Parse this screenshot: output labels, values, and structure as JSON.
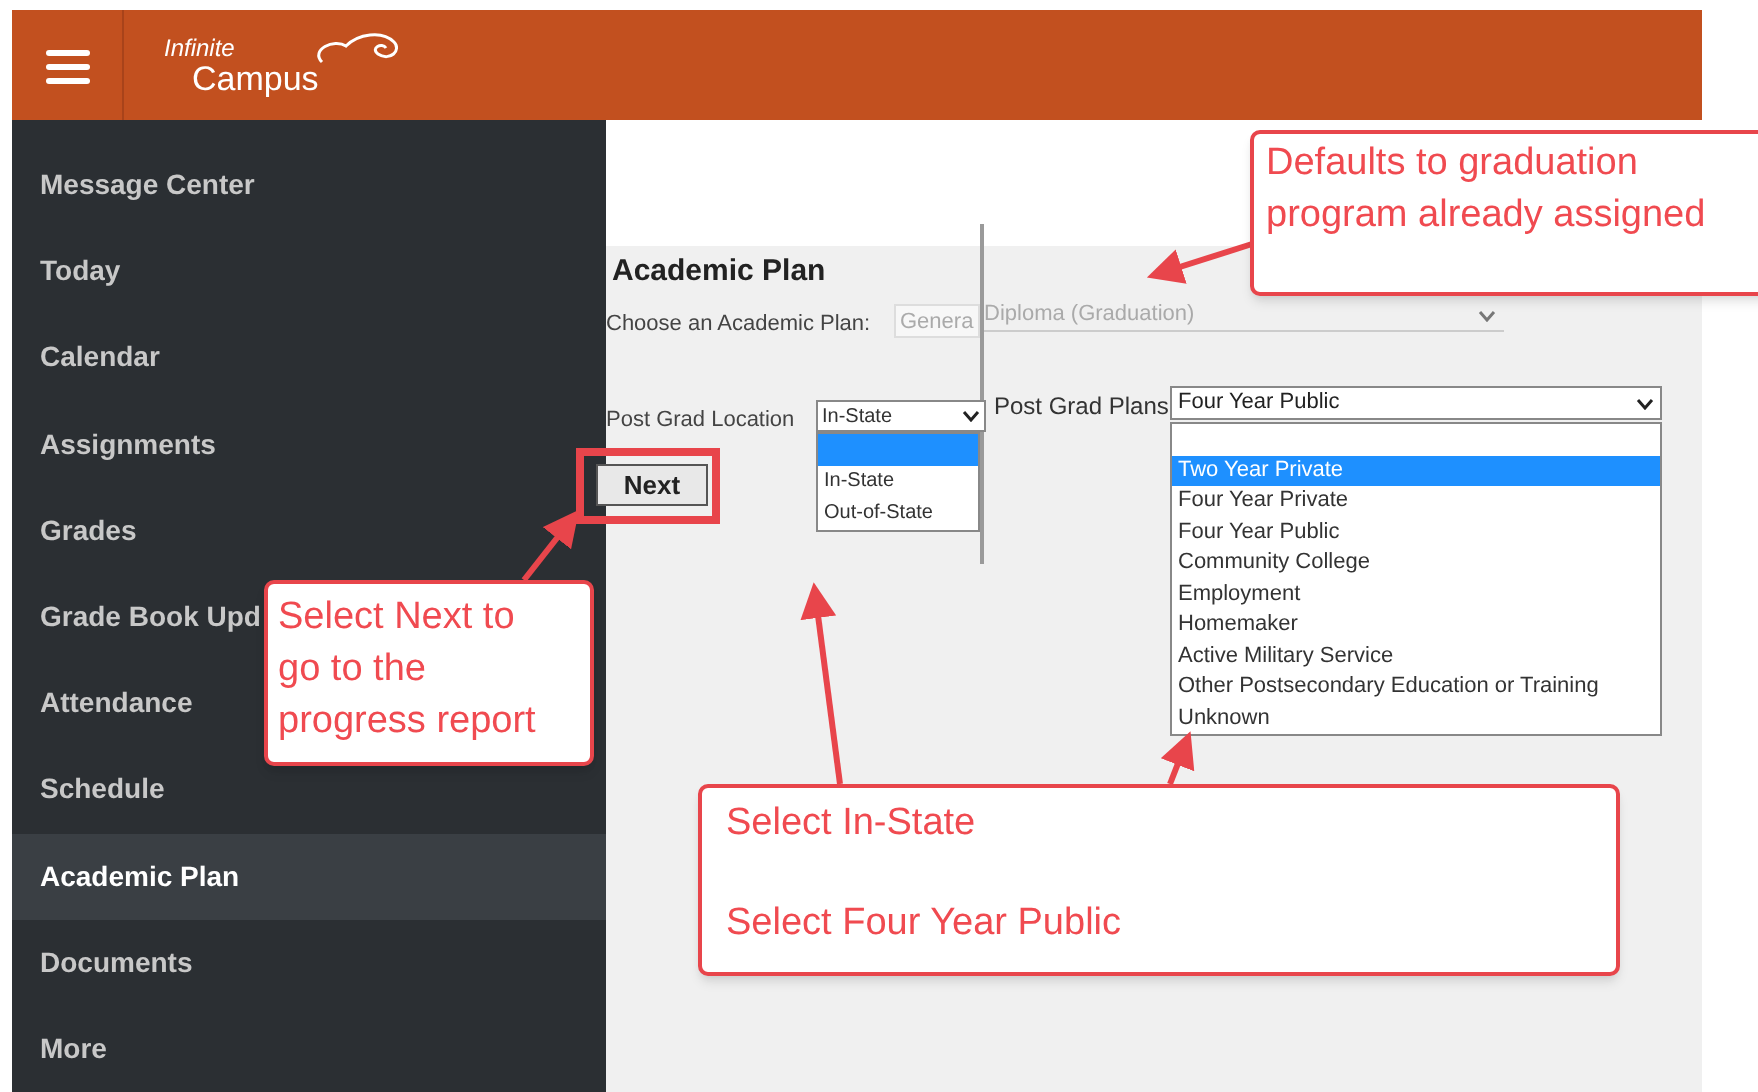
{
  "header": {
    "logo": {
      "line1": "Infinite",
      "line2": "Campus"
    }
  },
  "sidebar": {
    "items": [
      {
        "label": "Message Center",
        "selected": false
      },
      {
        "label": "Today",
        "selected": false
      },
      {
        "label": "Calendar",
        "selected": false
      },
      {
        "label": "Assignments",
        "selected": false
      },
      {
        "label": "Grades",
        "selected": false
      },
      {
        "label": "Grade Book Upd",
        "selected": false
      },
      {
        "label": "Attendance",
        "selected": false
      },
      {
        "label": "Schedule",
        "selected": false
      },
      {
        "label": "Academic Plan",
        "selected": true
      },
      {
        "label": "Documents",
        "selected": false
      },
      {
        "label": "More",
        "selected": false
      }
    ]
  },
  "academic_plan": {
    "title": "Academic Plan",
    "plan_label": "Choose an Academic Plan:",
    "plan_value": "Genera",
    "diploma_value": "Diploma (Graduation)",
    "location_label": "Post Grad Location",
    "location_value": "In-State",
    "location_blank_selected": true,
    "location_options": [
      {
        "label": "In-State",
        "selected": false
      },
      {
        "label": "Out-of-State",
        "selected": false
      }
    ],
    "next_button": "Next",
    "plans_label": "Post Grad Plans",
    "plans_value": "Four Year Public",
    "plans_blank_selected": false,
    "plans_options": [
      {
        "label": "Two Year Private",
        "selected": true
      },
      {
        "label": "Four Year Private",
        "selected": false
      },
      {
        "label": "Four Year Public",
        "selected": false
      },
      {
        "label": "Community College",
        "selected": false
      },
      {
        "label": "Employment",
        "selected": false
      },
      {
        "label": "Homemaker",
        "selected": false
      },
      {
        "label": "Active Military Service",
        "selected": false
      },
      {
        "label": "Other Postsecondary Education or Training",
        "selected": false
      },
      {
        "label": "Unknown",
        "selected": false
      }
    ]
  },
  "callouts": [
    {
      "lines": [
        "Defaults to graduation program already assigned"
      ]
    },
    {
      "lines": [
        "Select Next to go to the progress report"
      ]
    },
    {
      "lines": [
        "Select In-State",
        "Select Four Year Public"
      ]
    }
  ]
}
